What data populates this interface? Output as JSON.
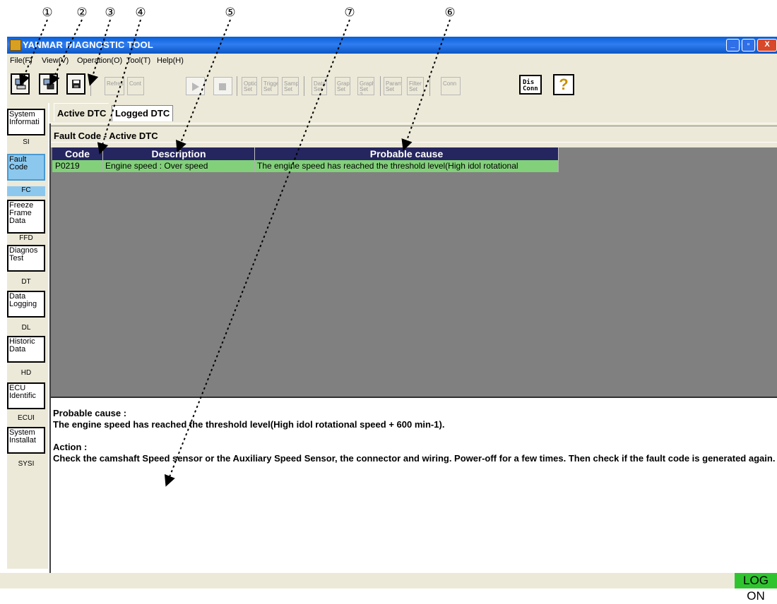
{
  "callouts": [
    "①",
    "②",
    "③",
    "④",
    "⑤",
    "⑦",
    "⑥"
  ],
  "window": {
    "title": "YANMAR DIAGNOSTIC TOOL",
    "min": "_",
    "max": "▫",
    "close": "X"
  },
  "menu": [
    "File(F)",
    "View(V)",
    "Operation(O)",
    "Tool(T)",
    "Help(H)"
  ],
  "toolbar": {
    "buttons": [
      "Refresh",
      "Cont",
      "Option Set",
      "Trigger Set",
      "Sample Set",
      "Data Set",
      "Graph Set",
      "Graph Set 2",
      "Param Set",
      "Filter Set",
      "Conn",
      "Dis Conn"
    ],
    "help": "?"
  },
  "sidebar": {
    "items": [
      {
        "label": "System Informati",
        "abbr": "SI"
      },
      {
        "label": "Fault Code",
        "abbr": "FC",
        "selected": true
      },
      {
        "label": "Freeze Frame Data",
        "abbr": "FFD"
      },
      {
        "label": "Diagnos Test",
        "abbr": "DT"
      },
      {
        "label": "Data Logging",
        "abbr": "DL"
      },
      {
        "label": "Historic Data",
        "abbr": "HD"
      },
      {
        "label": "ECU Identific",
        "abbr": "ECUI"
      },
      {
        "label": "System Installat",
        "abbr": "SYSI"
      }
    ]
  },
  "tabs": [
    "Active DTC",
    "Logged DTC"
  ],
  "section_title": "Fault Code - Active DTC",
  "table": {
    "columns": [
      "Code",
      "Description",
      "Probable cause"
    ],
    "rows": [
      [
        "P0219",
        "Engine speed : Over speed",
        "The engine speed has reached the threshold level(High idol rotational"
      ]
    ]
  },
  "detail": {
    "cause_label": "Probable cause :",
    "cause_text": "The engine speed has reached the threshold level(High idol rotational speed + 600 min-1).",
    "action_label": "Action :",
    "action_text": "Check the camshaft Speed sensor or the Auxiliary Speed Sensor, the connector and wiring. Power-off for a few times. Then check if the fault code is generated again."
  },
  "status": {
    "log_state": "LOG ON"
  },
  "colors": {
    "title_bar": "#2f7df0",
    "selected_nav": "#8cc8ee",
    "table_header": "#252560",
    "row_highlight": "#82d07a",
    "grid_bg": "#808080",
    "log_on": "#2fc42f"
  }
}
